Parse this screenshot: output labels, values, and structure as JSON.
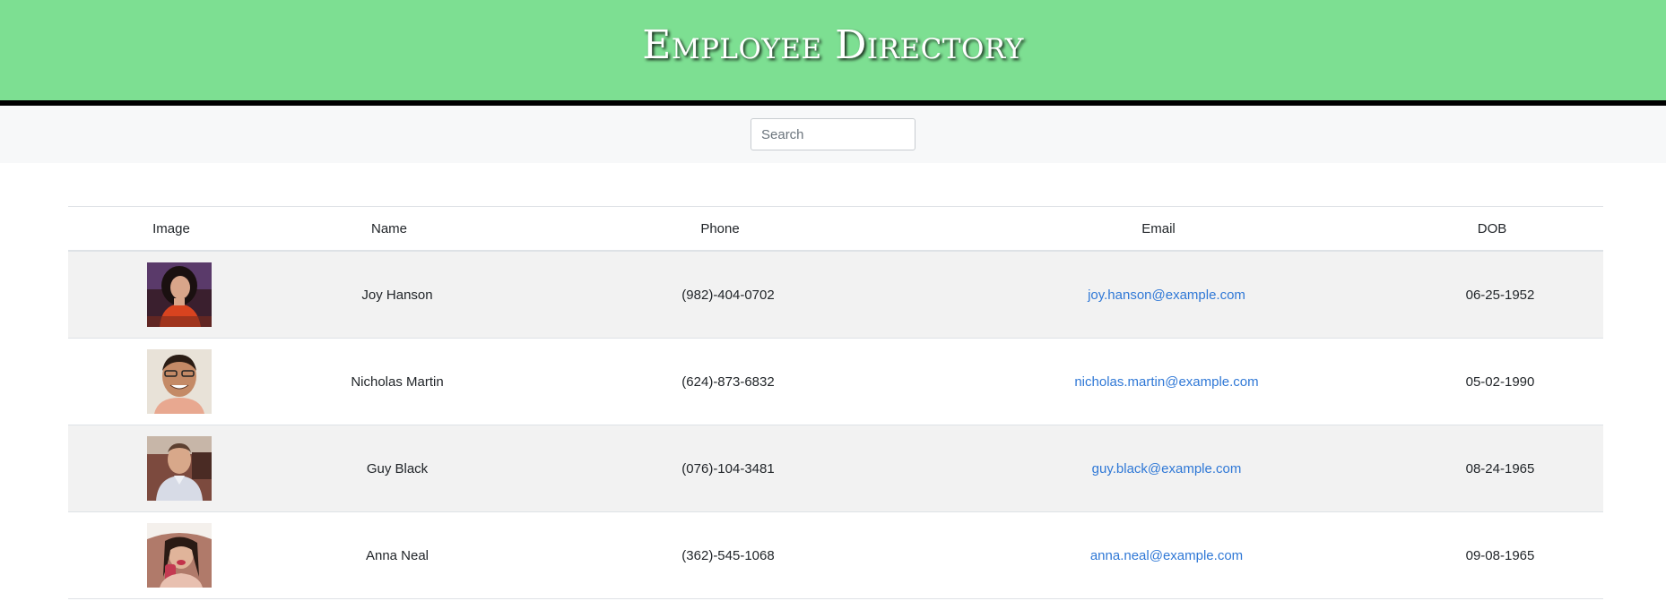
{
  "header": {
    "title": "Employee Directory"
  },
  "search": {
    "placeholder": "Search",
    "value": ""
  },
  "table": {
    "columns": [
      "Image",
      "Name",
      "Phone",
      "Email",
      "DOB"
    ],
    "rows": [
      {
        "name": "Joy Hanson",
        "phone": "(982)-404-0702",
        "email": "joy.hanson@example.com",
        "dob": "06-25-1952"
      },
      {
        "name": "Nicholas Martin",
        "phone": "(624)-873-6832",
        "email": "nicholas.martin@example.com",
        "dob": "05-02-1990"
      },
      {
        "name": "Guy Black",
        "phone": "(076)-104-3481",
        "email": "guy.black@example.com",
        "dob": "08-24-1965"
      },
      {
        "name": "Anna Neal",
        "phone": "(362)-545-1068",
        "email": "anna.neal@example.com",
        "dob": "09-08-1965"
      }
    ]
  },
  "colors": {
    "header_bg": "#7ddf92",
    "header_border": "#000000",
    "link": "#2f78d6",
    "row_stripe": "#f2f2f2"
  }
}
